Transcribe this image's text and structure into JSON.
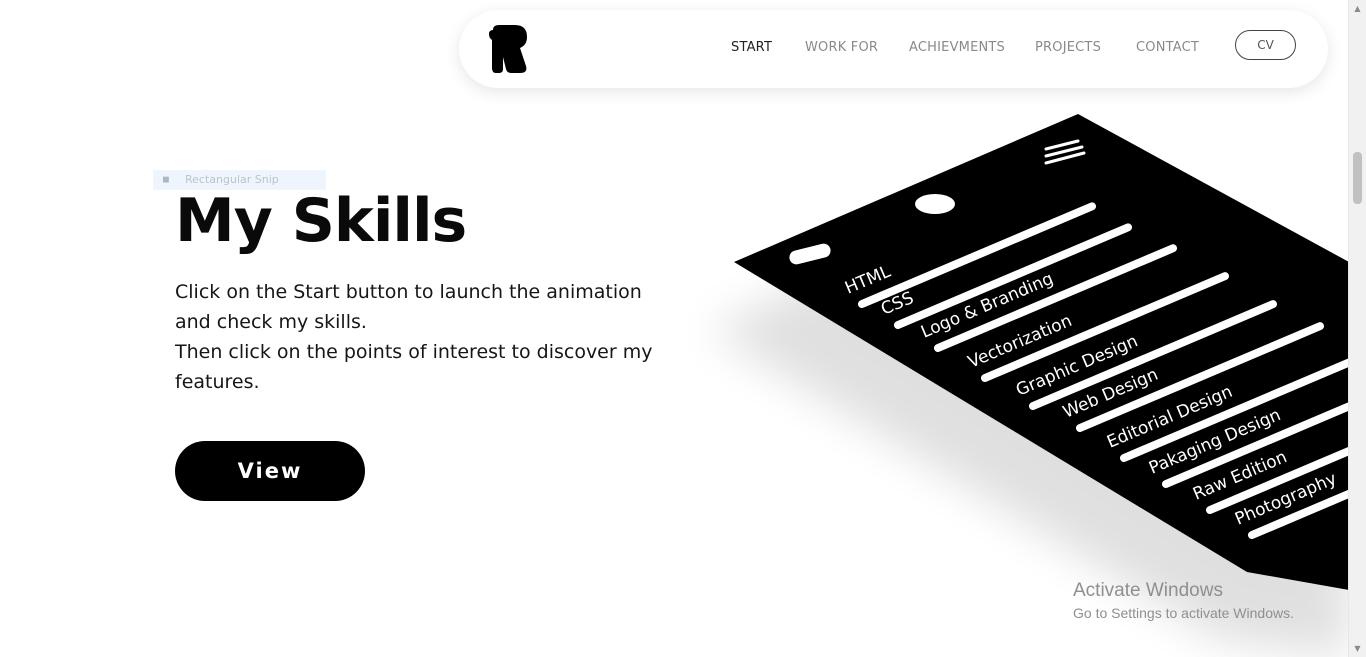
{
  "nav": {
    "links": [
      "START",
      "WORK FOR",
      "ACHIEVMENTS",
      "PROJECTS",
      "CONTACT"
    ],
    "active": "START",
    "cv_label": "CV"
  },
  "snip": {
    "label": "Rectangular Snip"
  },
  "hero": {
    "title": "My Skills",
    "line1": "Click on the Start button to launch the animation and check my skills.",
    "line2": "Then click on the points of interest to discover my features.",
    "button_label": "View"
  },
  "skills": [
    "HTML",
    "CSS",
    "Logo & Branding",
    "Vectorization",
    "Graphic Design",
    "Web Design",
    "Editorial Design",
    "Pakaging Design",
    "Raw Edition",
    "Photography"
  ],
  "watermark": {
    "title": "Activate Windows",
    "subtitle": "Go to Settings to activate Windows."
  },
  "colors": {
    "primary": "#000000",
    "text": "#111111",
    "muted": "#8a8a8a"
  }
}
